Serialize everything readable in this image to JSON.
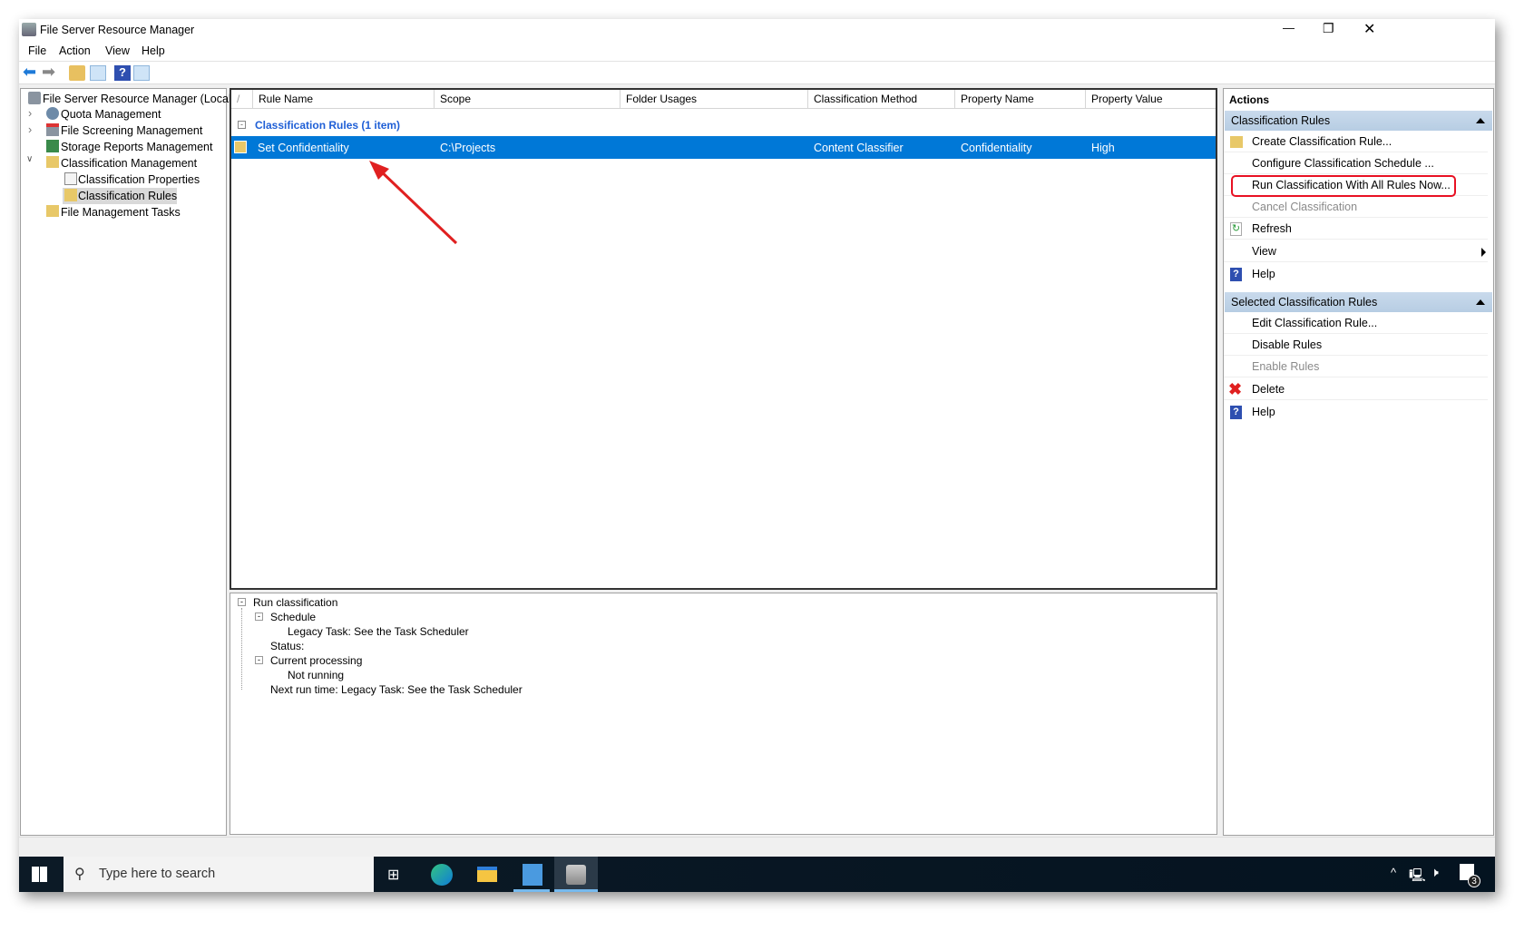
{
  "window": {
    "title": "File Server Resource Manager",
    "controls": {
      "minimize": "—",
      "restore": "❐",
      "close": "✕"
    }
  },
  "menu": [
    "File",
    "Action",
    "View",
    "Help"
  ],
  "tree": {
    "root": "File Server Resource Manager (Local)",
    "items": [
      "Quota Management",
      "File Screening Management",
      "Storage Reports Management",
      "Classification Management",
      "Classification Properties",
      "Classification Rules",
      "File Management Tasks"
    ]
  },
  "list": {
    "columns": [
      "Rule Name",
      "Scope",
      "Folder Usages",
      "Classification Method",
      "Property Name",
      "Property Value"
    ],
    "sort_indicator": "/",
    "group": "Classification Rules (1 item)",
    "rows": [
      {
        "rule_name": "Set Confidentiality",
        "scope": "C:\\Projects",
        "folder_usages": "",
        "method": "Content Classifier",
        "property_name": "Confidentiality",
        "property_value": "High"
      }
    ]
  },
  "details": {
    "run": "Run classification",
    "schedule": "Schedule",
    "schedule_value": "Legacy Task: See the Task Scheduler",
    "status": "Status:",
    "current": "Current processing",
    "current_value": "Not running",
    "next": "Next run time: Legacy Task: See the Task Scheduler"
  },
  "actions": {
    "title": "Actions",
    "section1": "Classification Rules",
    "items1": [
      "Create Classification Rule...",
      "Configure Classification Schedule ...",
      "Run Classification With All Rules Now...",
      "Cancel Classification",
      "Refresh",
      "View",
      "Help"
    ],
    "section2": "Selected Classification Rules",
    "items2": [
      "Edit Classification Rule...",
      "Disable Rules",
      "Enable Rules",
      "Delete",
      "Help"
    ]
  },
  "taskbar": {
    "search_placeholder": "Type here to search",
    "notifications": "3"
  },
  "colors": {
    "selection": "#0078d7",
    "group": "#1f5fd6",
    "highlight": "#e81123",
    "annotation": "#e02020"
  }
}
